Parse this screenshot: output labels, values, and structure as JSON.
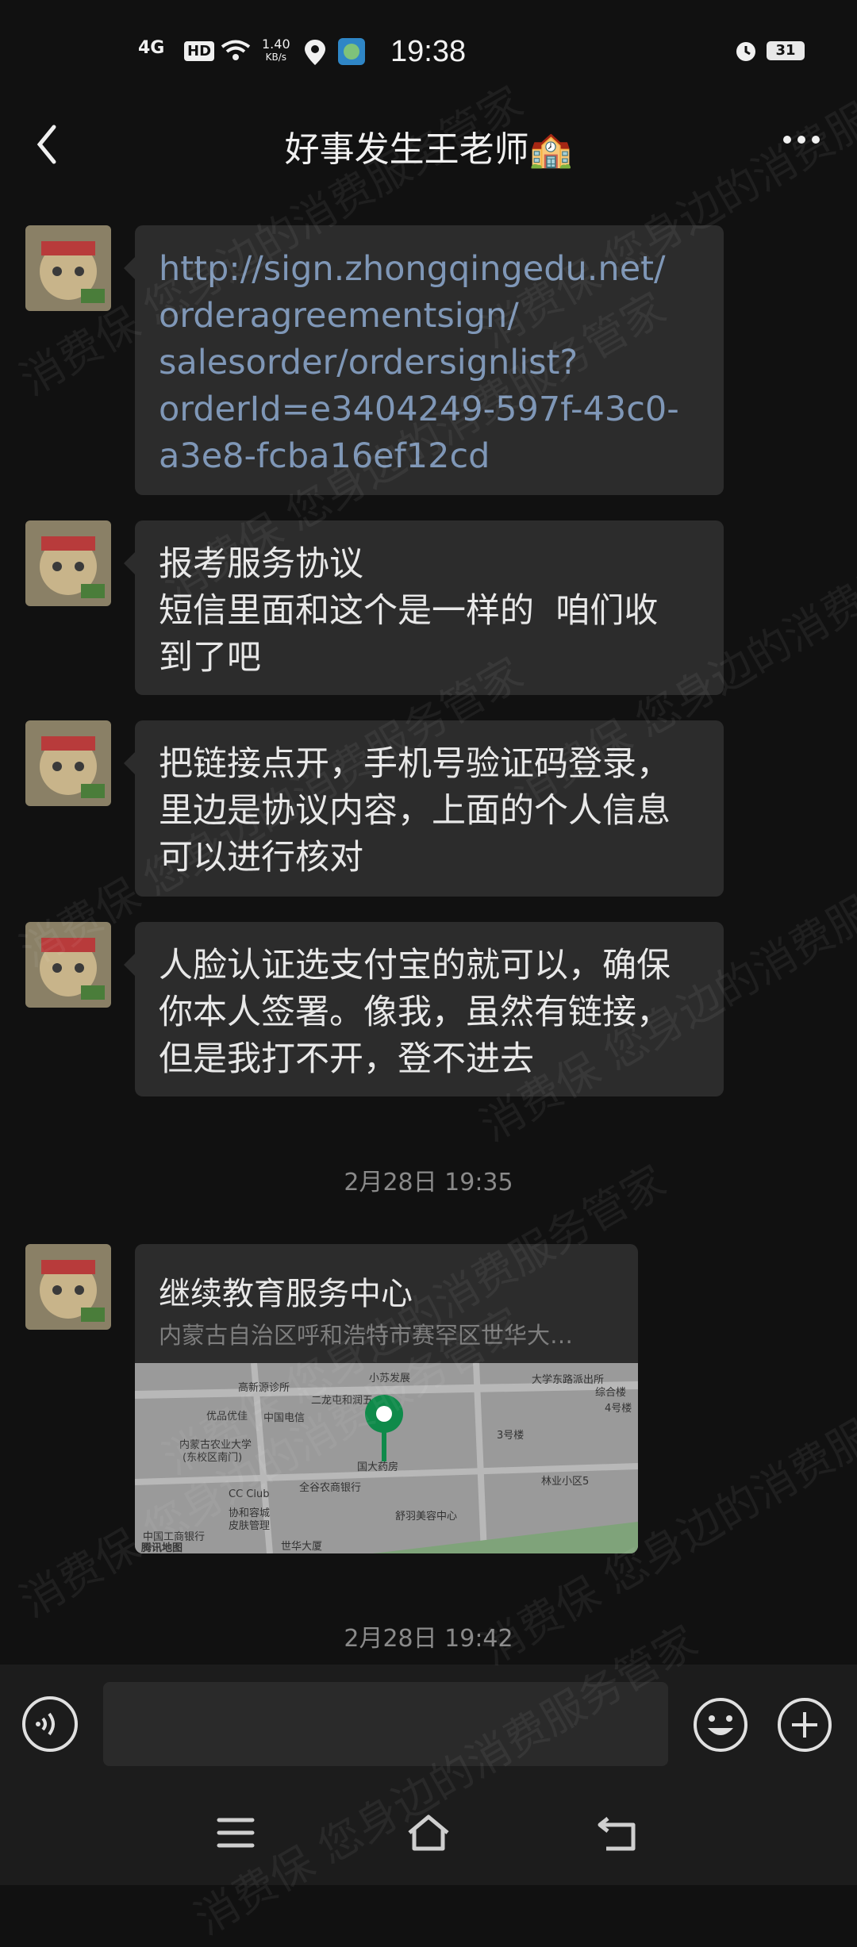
{
  "status_bar": {
    "network": "4G",
    "hd": "HD",
    "speed_value": "1.40",
    "speed_unit": "KB/s",
    "time": "19:38",
    "battery": "31"
  },
  "header": {
    "title": "好事发生王老师🏫",
    "back_icon": "chevron-left-icon",
    "more_icon": "more-dots-icon"
  },
  "messages": [
    {
      "type": "text",
      "link": true,
      "lines": [
        "http://sign.zhongqingedu.net/",
        "orderagreementsign/",
        "salesorder/ordersignlist?",
        "orderId=e3404249-597f-43c0-",
        "a3e8-fcba16ef12cd"
      ]
    },
    {
      "type": "text",
      "lines": [
        "报考服务协议",
        "短信里面和这个是一样的  咱们收",
        "到了吧"
      ]
    },
    {
      "type": "text",
      "lines": [
        "把链接点开，手机号验证码登录，",
        "里边是协议内容，上面的个人信息",
        "可以进行核对"
      ]
    },
    {
      "type": "text",
      "lines": [
        "人脸认证选支付宝的就可以，确保",
        "你本人签署。像我，虽然有链接，",
        "但是我打不开，登不进去"
      ]
    }
  ],
  "timestamps": [
    "2月28日 19:35",
    "2月28日 19:42"
  ],
  "location_card": {
    "title": "继续教育服务中心",
    "address": "内蒙古自治区呼和浩特市赛罕区世华大…",
    "map_labels": [
      "小苏发展",
      "大学东路派出所",
      "综合楼",
      "高新源诊所",
      "二龙屯和润五",
      "中国电信",
      "优品优佳",
      "内蒙古农业大学",
      "(东校区南门)",
      "国大药房",
      "林业小区5",
      "CC Club",
      "全谷农商银行",
      "协和容城",
      "皮肤管理",
      "舒羽美容中心",
      "世华大厦",
      "中国工商银行",
      "腾讯地图",
      "4号楼",
      "3号楼"
    ]
  },
  "watermark_text": [
    "消费保 您身边的消费服务管家"
  ]
}
